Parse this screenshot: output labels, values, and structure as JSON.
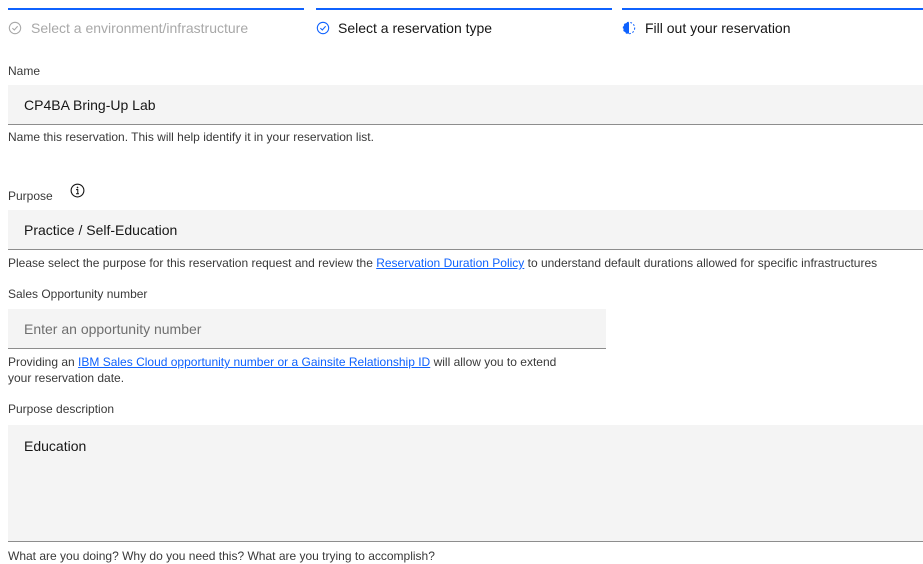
{
  "progress": {
    "steps": [
      {
        "label": "Select a environment/infrastructure",
        "state": "complete-disabled"
      },
      {
        "label": "Select a reservation type",
        "state": "complete"
      },
      {
        "label": "Fill out your reservation",
        "state": "current"
      }
    ]
  },
  "form": {
    "name": {
      "label": "Name",
      "value": "CP4BA Bring-Up Lab",
      "helper": "Name this reservation. This will help identify it in your reservation list."
    },
    "purpose": {
      "label": "Purpose",
      "value": "Practice / Self-Education",
      "helper_prefix": "Please select the purpose for this reservation request and review the ",
      "helper_link": "Reservation Duration Policy",
      "helper_suffix": " to understand default durations allowed for specific infrastructures"
    },
    "opportunity": {
      "label": "Sales Opportunity number",
      "placeholder": "Enter an opportunity number",
      "value": "",
      "helper_prefix": "Providing an ",
      "helper_link": "IBM Sales Cloud opportunity number or a Gainsite Relationship ID",
      "helper_suffix": " will allow you to extend",
      "helper_line2": "your reservation date."
    },
    "description": {
      "label": "Purpose description",
      "value": "Education",
      "helper": "What are you doing? Why do you need this? What are you trying to accomplish?"
    }
  },
  "colors": {
    "accent": "#0f62fe",
    "field_bg": "#f4f4f4",
    "disabled_text": "#a8a8a8"
  }
}
